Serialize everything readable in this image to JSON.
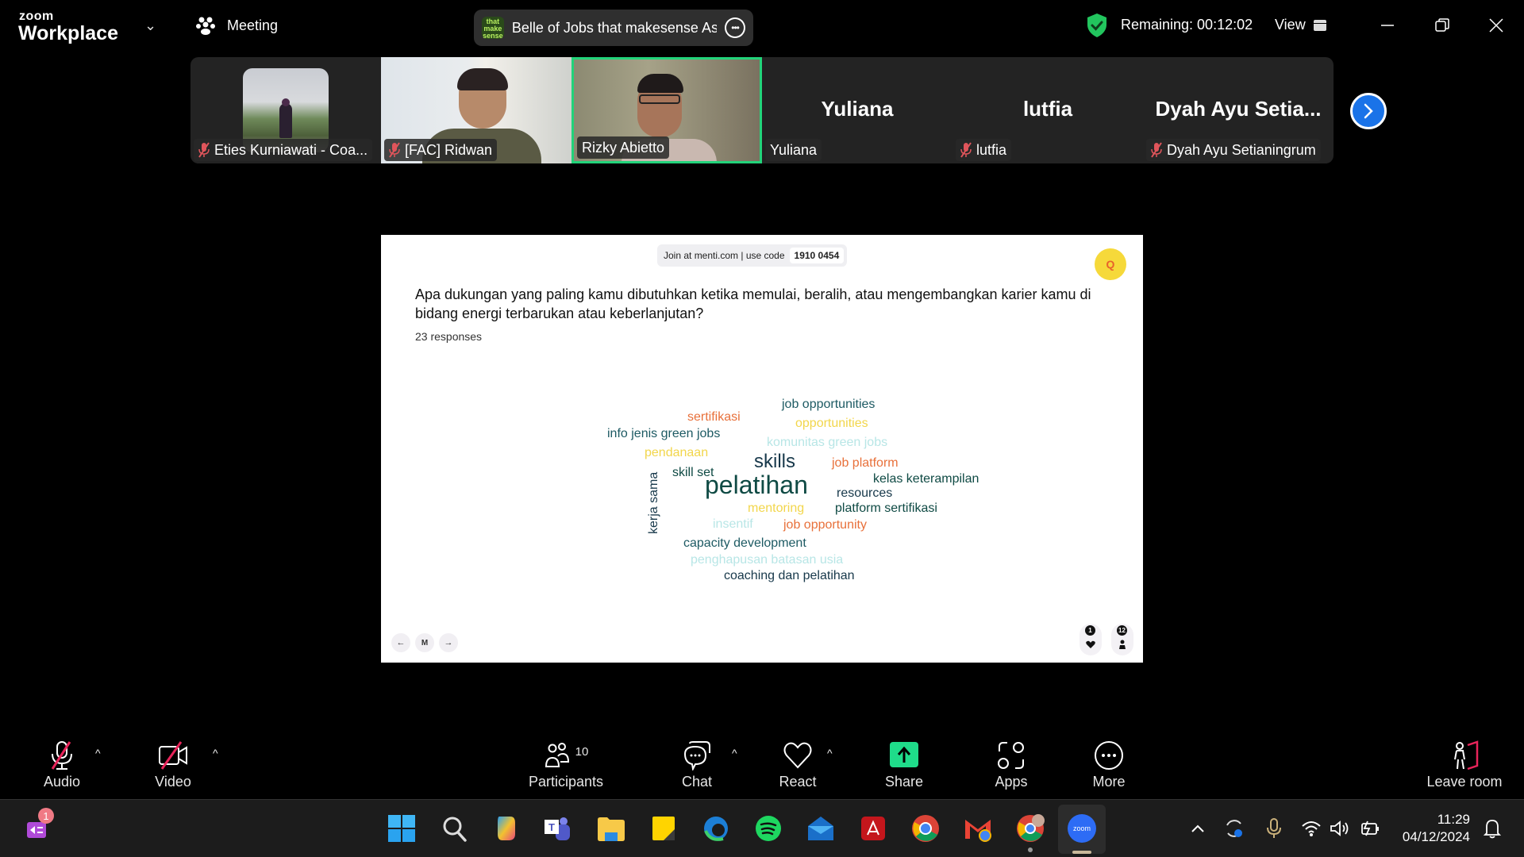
{
  "titlebar": {
    "brand_small": "zoom",
    "brand_big": "Workplace",
    "meeting_label": "Meeting",
    "meeting_logo_text": "that make sense",
    "meeting_title": "Belle of Jobs that makesense Asia",
    "remaining": "Remaining: 00:12:02",
    "view_label": "View"
  },
  "participants_strip": {
    "tiles": [
      {
        "name": "Eties Kurniawati - Coa...",
        "muted": true,
        "video": "avatar-photo"
      },
      {
        "name": "[FAC] Ridwan",
        "muted": true,
        "video": "camera"
      },
      {
        "name": "Rizky Abietto",
        "muted": false,
        "video": "camera",
        "active_speaker": true
      },
      {
        "name": "Yuliana",
        "display_name": "Yuliana",
        "muted": false,
        "video": "off"
      },
      {
        "name": "lutfia",
        "display_name": "lutfia",
        "muted": true,
        "video": "off"
      },
      {
        "name": "Dyah Ayu Setianingrum",
        "display_name": "Dyah  Ayu  Setia...",
        "muted": true,
        "video": "off"
      }
    ]
  },
  "slide": {
    "join_text": "Join at menti.com | use code",
    "code": "1910 0454",
    "question": "Apa dukungan yang paling kamu dibutuhkan ketika memulai, beralih, atau mengembangkan karier kamu di bidang energi terbarukan atau keberlanjutan?",
    "responses": "23 responses",
    "reaction_count": "1",
    "audience_count": "12",
    "word_cloud": [
      {
        "text": "job opportunities",
        "color": "#1d5a63",
        "weight": 2
      },
      {
        "text": "sertifikasi",
        "color": "#e8703a",
        "weight": 2
      },
      {
        "text": "opportunities",
        "color": "#f2d64b",
        "weight": 2
      },
      {
        "text": "info jenis green jobs",
        "color": "#1d5a63",
        "weight": 2
      },
      {
        "text": "komunitas green jobs",
        "color": "#b8e6e6",
        "weight": 2
      },
      {
        "text": "pendanaan",
        "color": "#f2d64b",
        "weight": 2
      },
      {
        "text": "skills",
        "color": "#17384a",
        "weight": 4
      },
      {
        "text": "job platform",
        "color": "#e8703a",
        "weight": 2
      },
      {
        "text": "skill set",
        "color": "#0f4a44",
        "weight": 2
      },
      {
        "text": "pelatihan",
        "color": "#0f4a44",
        "weight": 6
      },
      {
        "text": "kelas keterampilan",
        "color": "#0f4a44",
        "weight": 2
      },
      {
        "text": "resources",
        "color": "#17384a",
        "weight": 2
      },
      {
        "text": "kerja sama",
        "color": "#17384a",
        "weight": 2
      },
      {
        "text": "mentoring",
        "color": "#f2d64b",
        "weight": 2
      },
      {
        "text": "platform sertifikasi",
        "color": "#0f4a44",
        "weight": 2
      },
      {
        "text": "insentif",
        "color": "#b8e6e6",
        "weight": 2
      },
      {
        "text": "job opportunity",
        "color": "#e8703a",
        "weight": 2
      },
      {
        "text": "capacity development",
        "color": "#1d5a63",
        "weight": 2
      },
      {
        "text": "penghapusan batasan usia",
        "color": "#b8e6e6",
        "weight": 2
      },
      {
        "text": "coaching dan pelatihan",
        "color": "#17384a",
        "weight": 2
      }
    ]
  },
  "toolbar": {
    "audio": "Audio",
    "video": "Video",
    "participants": "Participants",
    "participants_count": "10",
    "chat": "Chat",
    "react": "React",
    "share": "Share",
    "apps": "Apps",
    "more": "More",
    "leave": "Leave room"
  },
  "taskbar": {
    "notification_badge": "1",
    "apps": [
      "Start",
      "Search",
      "Copilot",
      "Teams",
      "File Explorer",
      "Sticky Notes",
      "Edge",
      "Spotify",
      "Mail",
      "Adobe Acrobat",
      "Chrome",
      "Gmail",
      "Chrome (profile)",
      "Zoom"
    ],
    "zoom_icon_text": "zoom",
    "time": "11:29",
    "date": "04/12/2024"
  },
  "colors": {
    "accent_green": "#22d37a",
    "muted_red": "#e0555b",
    "next_blue": "#1a73e8",
    "share_green": "#1fdc8a",
    "leave_red": "#e8245a"
  }
}
